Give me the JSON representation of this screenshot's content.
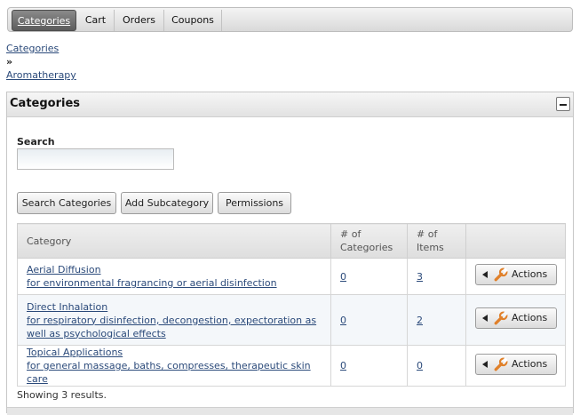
{
  "tabs": [
    {
      "label": "Categories",
      "active": true
    },
    {
      "label": "Cart",
      "active": false
    },
    {
      "label": "Orders",
      "active": false
    },
    {
      "label": "Coupons",
      "active": false
    }
  ],
  "breadcrumb": {
    "items": [
      "Categories",
      "Aromatherapy"
    ],
    "separator": "»"
  },
  "panel": {
    "title": "Categories",
    "search_label": "Search",
    "search_value": "",
    "buttons": [
      "Search Categories",
      "Add Subcategory",
      "Permissions"
    ]
  },
  "table": {
    "headers": [
      "Category",
      "# of Categories",
      "# of Items",
      ""
    ],
    "rows": [
      {
        "name": "Aerial Diffusion",
        "description": "for environmental fragrancing or aerial disinfection",
        "categories": "0",
        "items": "3",
        "action": "Actions"
      },
      {
        "name": "Direct Inhalation",
        "description": "for respiratory disinfection, decongestion, expectoration as well as psychological effects",
        "categories": "0",
        "items": "2",
        "action": "Actions"
      },
      {
        "name": "Topical Applications",
        "description": "for general massage, baths, compresses, therapeutic skin care",
        "categories": "0",
        "items": "0",
        "action": "Actions"
      }
    ],
    "footer": "Showing 3 results."
  },
  "colors": {
    "link": "#2b4a7a",
    "active_tab": "#5c5c5c",
    "row_alt": "#f4f7fa"
  }
}
